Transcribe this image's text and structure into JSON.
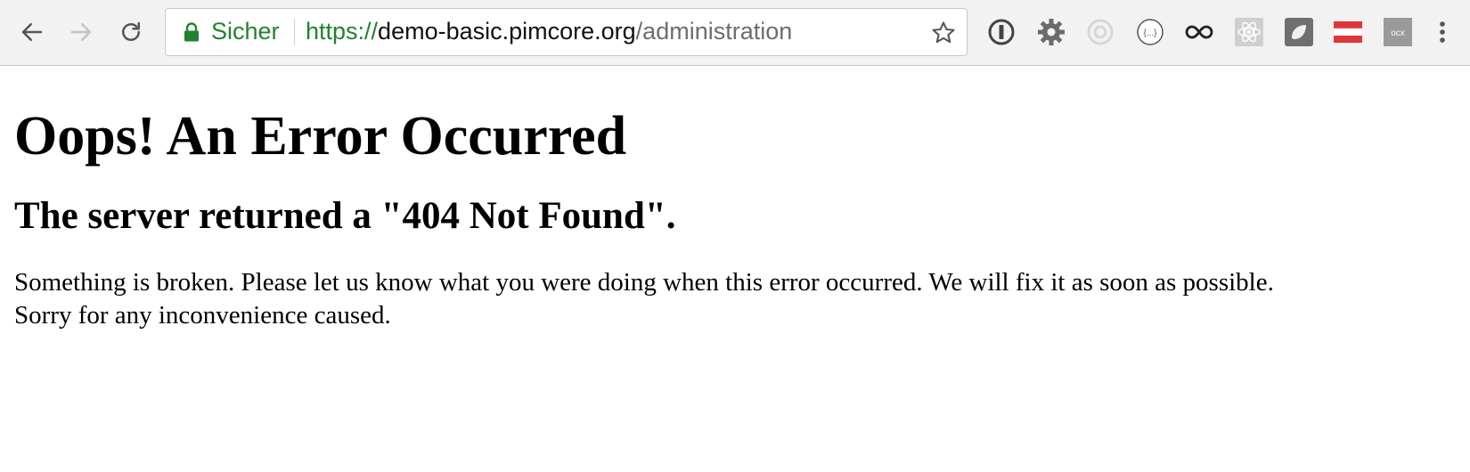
{
  "browser": {
    "address_bar": {
      "security_label": "Sicher",
      "url_scheme": "https://",
      "url_host": "demo-basic.pimcore.org",
      "url_path": "/administration"
    },
    "nav_icons": [
      "back-arrow-icon",
      "forward-arrow-icon",
      "reload-icon"
    ],
    "extension_icons": [
      "password-manager-icon",
      "gear-extension-icon",
      "target-extension-icon",
      "json-formatter-icon",
      "infinity-extension-icon",
      "react-devtools-icon",
      "shape-extension-icon",
      "flag-extension-icon",
      "ocx-extension-icon",
      "menu-kebab-icon"
    ],
    "colors": {
      "secure_green": "#22822f",
      "toolbar_bg": "#f2f2f2"
    }
  },
  "page": {
    "heading": "Oops! An Error Occurred",
    "subheading": "The server returned a \"404 Not Found\".",
    "message_line1": "Something is broken. Please let us know what you were doing when this error occurred. We will fix it as soon as possible.",
    "message_line2": "Sorry for any inconvenience caused."
  }
}
